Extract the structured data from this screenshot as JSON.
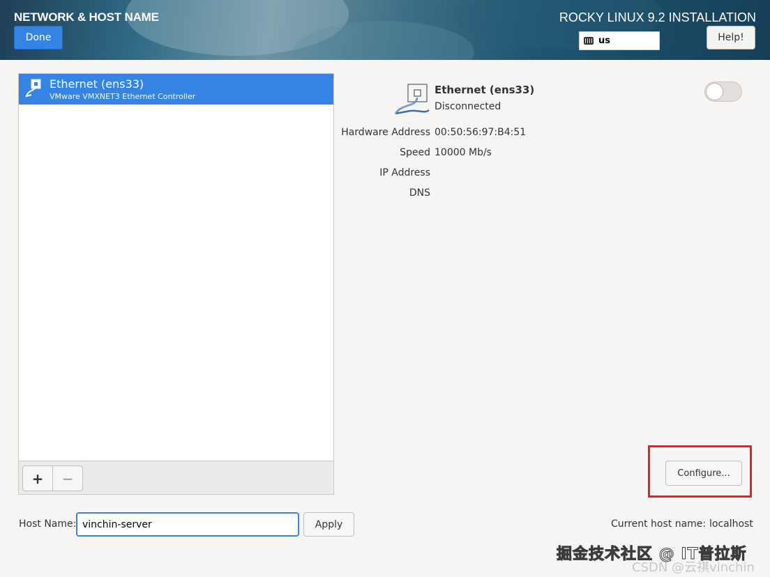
{
  "header": {
    "spoke_title": "NETWORK & HOST NAME",
    "done_label": "Done",
    "product_title": "ROCKY LINUX 9.2 INSTALLATION",
    "keyboard_layout": "us",
    "help_label": "Help!"
  },
  "devices": [
    {
      "name": "Ethernet (ens33)",
      "description": "VMware VMXNET3 Ethernet Controller"
    }
  ],
  "toolbar": {
    "add_label": "+",
    "remove_label": "−"
  },
  "detail": {
    "name": "Ethernet (ens33)",
    "status": "Disconnected",
    "connected": false,
    "rows": [
      {
        "label": "Hardware Address",
        "value": "00:50:56:97:B4:51"
      },
      {
        "label": "Speed",
        "value": "10000 Mb/s"
      },
      {
        "label": "IP Address",
        "value": ""
      },
      {
        "label": "DNS",
        "value": ""
      }
    ],
    "configure_label": "Configure..."
  },
  "hostname": {
    "label": "Host Name:",
    "value": "vinchin-server",
    "apply_label": "Apply",
    "current_label": "Current host name:",
    "current_value": "localhost"
  },
  "watermark": {
    "line1": "掘金技术社区 @ IT普拉斯",
    "line2": "CSDN @云祺vinchin"
  },
  "colors": {
    "accent": "#3584e4",
    "highlight": "#ee1c1c"
  }
}
